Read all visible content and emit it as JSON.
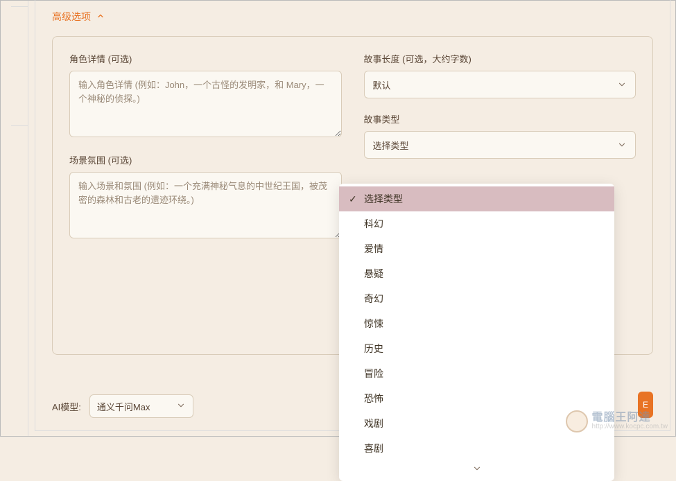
{
  "header": {
    "advanced_options": "高级选项"
  },
  "panel": {
    "character_label": "角色详情 (可选)",
    "character_placeholder": "输入角色详情 (例如：John，一个古怪的发明家，和 Mary，一个神秘的侦探。)",
    "scene_label": "场景氛围 (可选)",
    "scene_placeholder": "输入场景和氛围 (例如：一个充满神秘气息的中世纪王国，被茂密的森林和古老的遗迹环绕。)",
    "story_length_label": "故事长度 (可选，大约字数)",
    "story_length_value": "默认",
    "story_type_label": "故事类型",
    "story_type_value": "选择类型"
  },
  "dropdown": {
    "items": [
      "选择类型",
      "科幻",
      "爱情",
      "悬疑",
      "奇幻",
      "惊悚",
      "历史",
      "冒险",
      "恐怖",
      "戏剧",
      "喜剧"
    ],
    "selected_index": 0
  },
  "footer": {
    "model_label": "AI模型:",
    "model_value": "通义千问Max",
    "button_frag": "E"
  },
  "watermark": {
    "title": "電腦王阿達",
    "url": "http://www.kocpc.com.tw"
  }
}
